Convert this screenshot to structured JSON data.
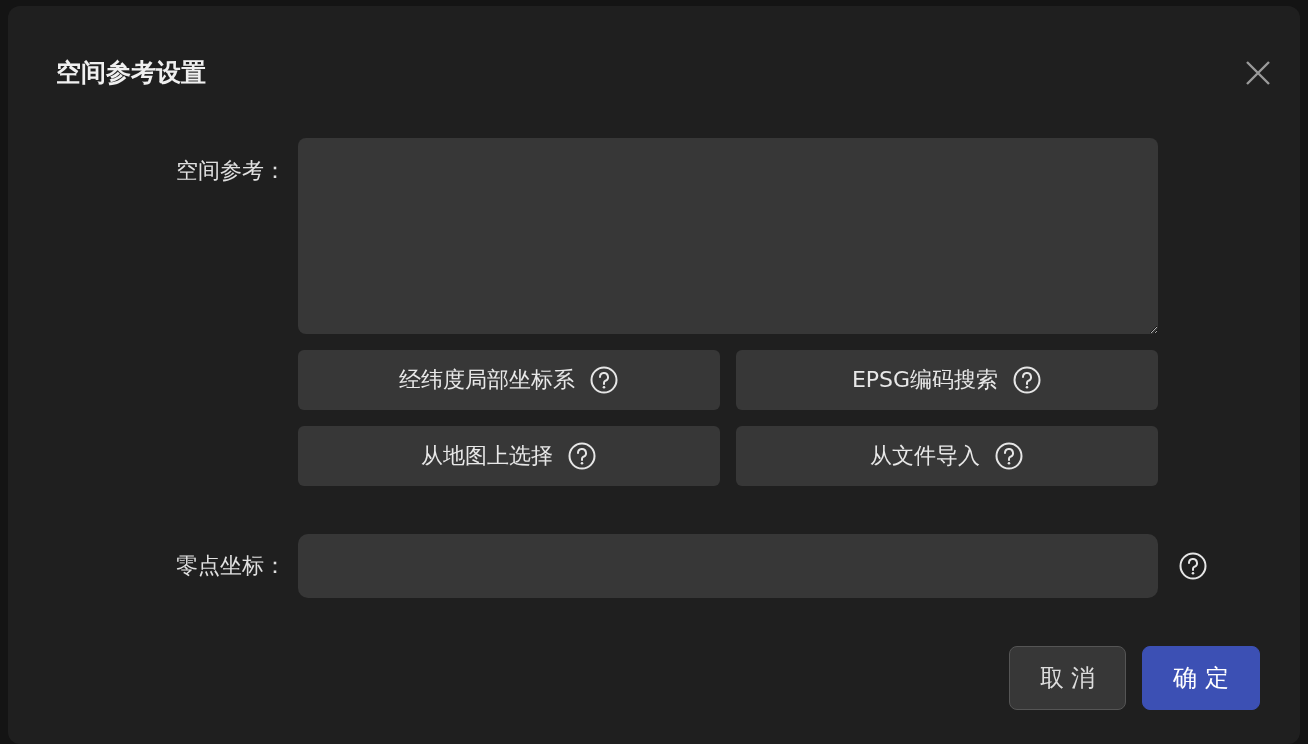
{
  "dialog": {
    "title": "空间参考设置",
    "fields": [
      {
        "label": "空间参考：",
        "kind": "textarea"
      },
      {
        "label": "零点坐标：",
        "kind": "input",
        "help": true
      }
    ],
    "action_buttons": [
      {
        "label": "经纬度局部坐标系"
      },
      {
        "label": "EPSG编码搜索"
      },
      {
        "label": "从地图上选择"
      },
      {
        "label": "从文件导入"
      }
    ],
    "footer_buttons": [
      {
        "label": "取 消",
        "kind": "secondary"
      },
      {
        "label": "确 定",
        "kind": "primary"
      }
    ]
  }
}
